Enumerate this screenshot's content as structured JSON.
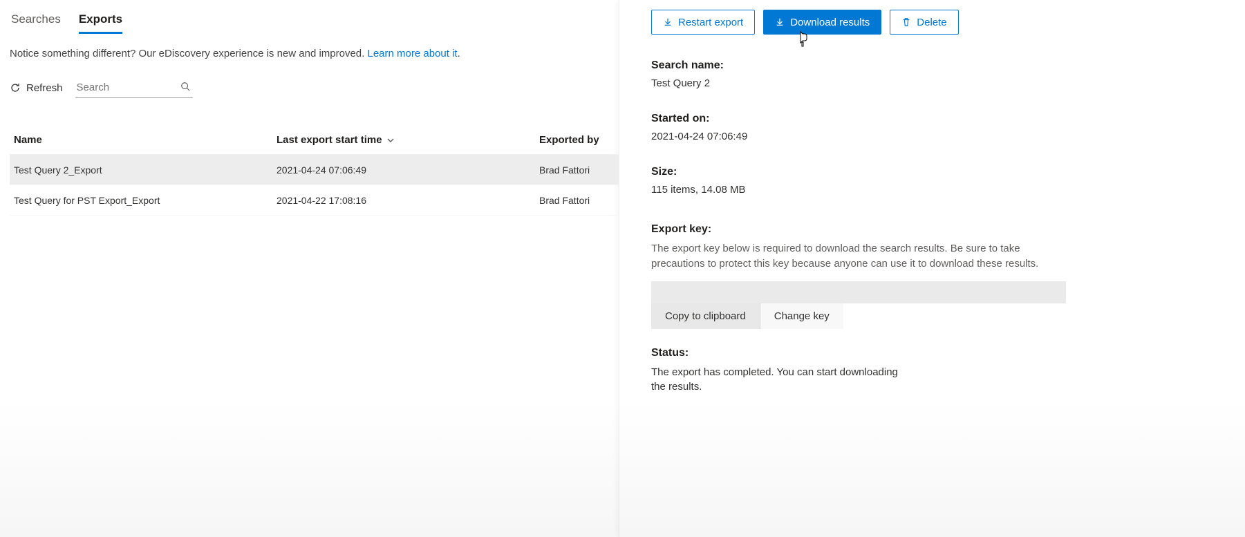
{
  "tabs": {
    "searches": "Searches",
    "exports": "Exports"
  },
  "notice": {
    "text": "Notice something different? Our eDiscovery experience is new and improved. ",
    "link": "Learn more about it",
    "dot": "."
  },
  "toolbar": {
    "refresh": "Refresh",
    "search_placeholder": "Search"
  },
  "columns": {
    "name": "Name",
    "last_start": "Last export start time",
    "exported_by": "Exported by"
  },
  "rows": [
    {
      "name": "Test Query 2_Export",
      "time": "2021-04-24 07:06:49",
      "by": "Brad Fattori"
    },
    {
      "name": "Test Query for PST Export_Export",
      "time": "2021-04-22 17:08:16",
      "by": "Brad Fattori"
    }
  ],
  "actions": {
    "restart": "Restart export",
    "download": "Download results",
    "delete": "Delete"
  },
  "details": {
    "search_name_label": "Search name:",
    "search_name_value": "Test Query 2",
    "started_label": "Started on:",
    "started_value": "2021-04-24 07:06:49",
    "size_label": "Size:",
    "size_value": "115 items, 14.08 MB",
    "export_key_label": "Export key:",
    "export_key_note": "The export key below is required to download the search results. Be sure to take precautions to protect this key because anyone can use it to download these results.",
    "copy": "Copy to clipboard",
    "change": "Change key",
    "status_label": "Status:",
    "status_value": "The export has completed. You can start downloading the results."
  }
}
